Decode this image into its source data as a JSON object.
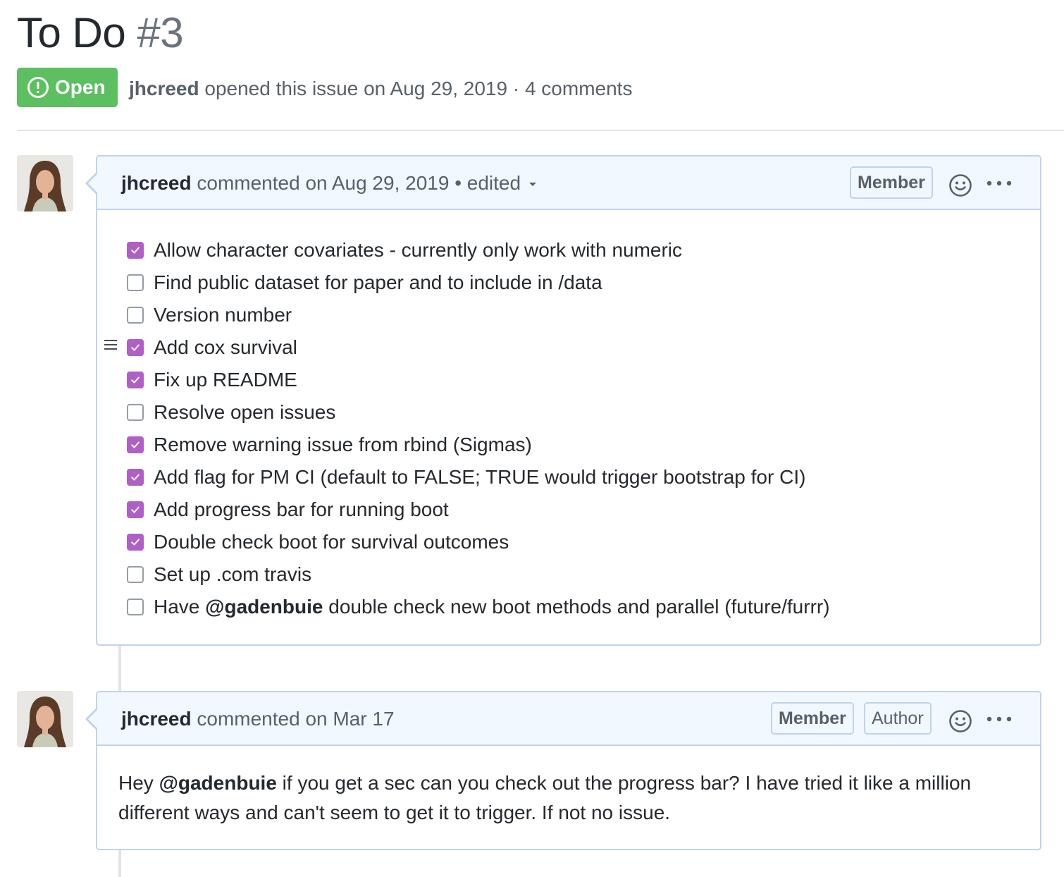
{
  "issue": {
    "title": "To Do",
    "number": "#3",
    "state": "Open",
    "author": "jhcreed",
    "opened_text": " opened this issue on Aug 29, 2019 · 4 comments"
  },
  "comments": [
    {
      "author": "jhcreed",
      "when": " commented on Aug 29, 2019 • edited",
      "badges": [
        "Member"
      ],
      "tasks": [
        {
          "checked": true,
          "text": "Allow character covariates - currently only work with numeric"
        },
        {
          "checked": false,
          "text": "Find public dataset for paper and to include in /data"
        },
        {
          "checked": false,
          "text": "Version number"
        },
        {
          "checked": true,
          "text": "Add cox survival"
        },
        {
          "checked": true,
          "text": "Fix up README"
        },
        {
          "checked": false,
          "text": "Resolve open issues"
        },
        {
          "checked": true,
          "text": "Remove warning issue from rbind (Sigmas)"
        },
        {
          "checked": true,
          "text": "Add flag for PM CI (default to FALSE; TRUE would trigger bootstrap for CI)"
        },
        {
          "checked": true,
          "text": "Add progress bar for running boot"
        },
        {
          "checked": true,
          "text": "Double check boot for survival outcomes"
        },
        {
          "checked": false,
          "text": "Set up .com travis"
        },
        {
          "checked": false,
          "pre": "Have ",
          "mention": "@gadenbuie",
          "post": " double check new boot methods and parallel (future/furrr)"
        }
      ]
    },
    {
      "author": "jhcreed",
      "when": " commented on Mar 17",
      "badges": [
        "Member",
        "Author"
      ],
      "body_pre": "Hey ",
      "body_mention": "@gadenbuie",
      "body_post": " if you get a sec can you check out the progress bar? I have tried it like a million different ways and can't seem to get it to trigger. If not no issue."
    }
  ],
  "icons": {
    "open": "issue-opened-icon",
    "reaction": "smiley-icon",
    "more": "kebab-horizontal-icon",
    "drag": "drag-handle-icon"
  },
  "colors": {
    "open_green": "#5cbf60",
    "checkbox_purple": "#b05fc6",
    "header_bg": "#f1f8ff",
    "border_blue": "#c0d3eb"
  }
}
